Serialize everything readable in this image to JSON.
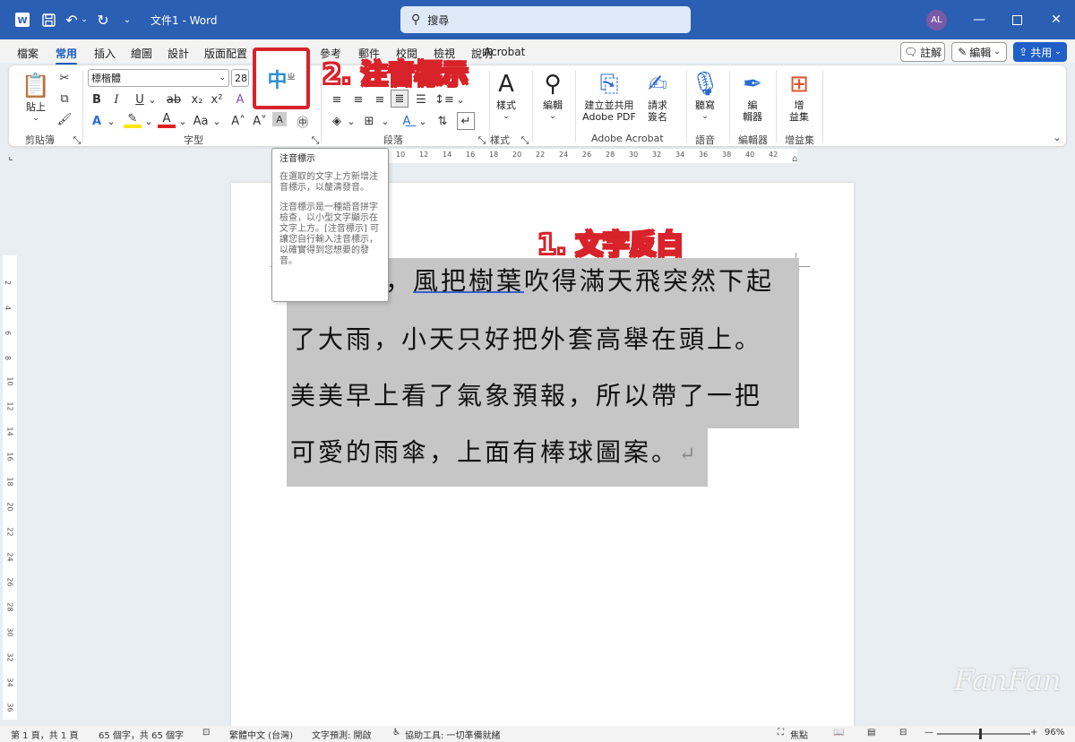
{
  "titlebar": {
    "doc_title": "文件1 - Word",
    "search_label": "搜尋",
    "avatar_initials": "AL"
  },
  "tabs": [
    "檔案",
    "常用",
    "插入",
    "繪圖",
    "設計",
    "版面配置",
    "參考",
    "郵件",
    "校閱",
    "檢視",
    "說明",
    "Acrobat"
  ],
  "tab_actions": {
    "comment": "註解",
    "edit": "編輯",
    "share": "共用"
  },
  "ribbon": {
    "clipboard": {
      "paste": "貼上",
      "label": "剪貼簿"
    },
    "font": {
      "name": "標楷體",
      "size": "28",
      "label": "字型"
    },
    "paragraph": {
      "label": "段落"
    },
    "styles": {
      "button": "樣式",
      "label": "樣式"
    },
    "editing": {
      "button": "編輯"
    },
    "acrobat": {
      "create_pdf_l1": "建立並共用",
      "create_pdf_l2": "Adobe PDF",
      "sign_l1": "請求",
      "sign_l2": "簽名",
      "label": "Adobe Acrobat"
    },
    "voice": {
      "button": "聽寫",
      "label": "語音"
    },
    "editor": {
      "button_l1": "編",
      "button_l2": "輯器",
      "label": "編輯器"
    },
    "addins": {
      "button_l1": "增",
      "button_l2": "益集",
      "label": "增益集"
    }
  },
  "ruler_numbers": [
    "10",
    "12",
    "14",
    "16",
    "18",
    "20",
    "22",
    "24",
    "26",
    "28",
    "30",
    "32",
    "34",
    "36",
    "38",
    "40",
    "42"
  ],
  "vruler_numbers": [
    "2",
    "4",
    "6",
    "8",
    "10",
    "12",
    "14",
    "16",
    "18",
    "20",
    "22",
    "24",
    "26",
    "28",
    "30",
    "32",
    "34",
    "36"
  ],
  "tooltip": {
    "title": "注音標示",
    "para1": "在選取的文字上方新增注音標示，以釐清發音。",
    "para2": "注音標示是一種語音拼字檢查，以小型文字顯示在文字上方。[注音標示] 可讓您自行輸入注音標示，以確實得到您想要的發音。"
  },
  "document": {
    "line1_prefix": "，",
    "line1_underlined": "風把樹葉",
    "line1_rest": "吹得滿天飛突然下起",
    "line2": "了大雨，小天只好把外套高舉在頭上。",
    "line3": "美美早上看了氣象預報，所以帶了一把",
    "line4": "可愛的雨傘，上面有棒球圖案。",
    "para_mark": "↵"
  },
  "annotations": {
    "step1": "1. 文字反白",
    "step2": "2. 注音標示"
  },
  "statusbar": {
    "page": "第 1 頁，共 1 頁",
    "words": "65 個字，共 65 個字",
    "language": "繁體中文 (台灣)",
    "prediction": "文字預測: 開啟",
    "accessibility": "協助工具: 一切準備就緒",
    "focus": "焦點",
    "zoom": "96%"
  },
  "watermark": "FanFan"
}
